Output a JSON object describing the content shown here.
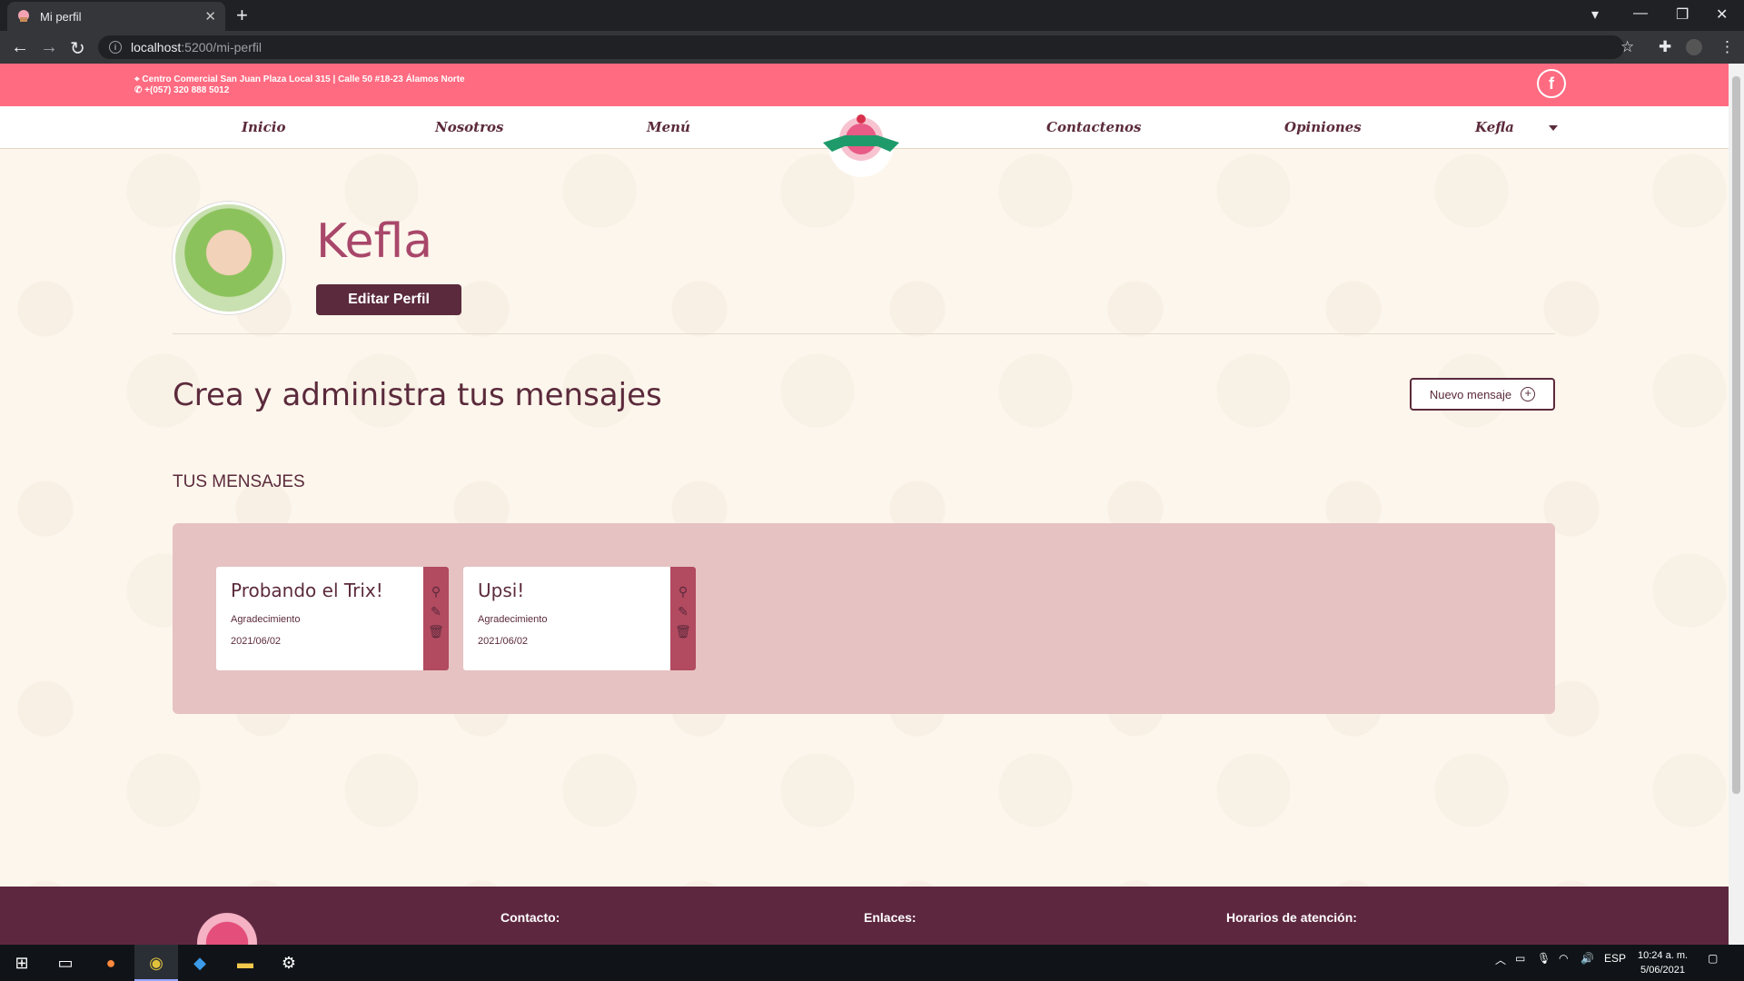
{
  "browser": {
    "tab_title": "Mi perfil",
    "url_host": "localhost",
    "url_path": ":5200/mi-perfil"
  },
  "site": {
    "address_line1": "Centro Comercial San Juan Plaza Local 315 | Calle 50 #18-23 Álamos Norte",
    "address_line2": "+(057) 320 888 5012",
    "facebook_label": "f",
    "nav": [
      "Inicio",
      "Nosotros",
      "Menú",
      "Contactenos",
      "Opiniones",
      "Kefla"
    ]
  },
  "profile": {
    "username": "Kefla",
    "edit_label": "Editar Perfil"
  },
  "messages": {
    "section_title": "Crea y administra tus mensajes",
    "new_label": "Nuevo mensaje",
    "list_title": "TUS MENSAJES",
    "items": [
      {
        "title": "Probando el Trix!",
        "category": "Agradecimiento",
        "date": "2021/06/02"
      },
      {
        "title": "Upsi!",
        "category": "Agradecimiento",
        "date": "2021/06/02"
      }
    ]
  },
  "footer": {
    "contact": "Contacto:",
    "links": "Enlaces:",
    "hours": "Horarios de atención:"
  },
  "taskbar": {
    "lang": "ESP",
    "time": "10:24 a. m.",
    "date": "5/06/2021"
  },
  "colors": {
    "brand_pink": "#ff6b81",
    "brand_wine": "#5b2a3c",
    "panel": "#e6c2c2"
  }
}
